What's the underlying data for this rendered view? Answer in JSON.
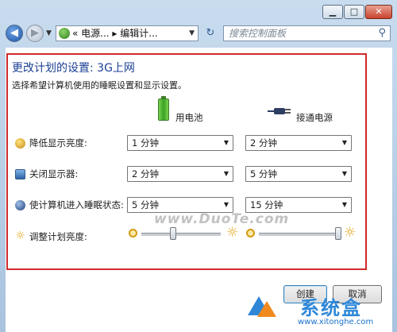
{
  "window": {
    "min_glyph": "▁",
    "max_glyph": "□",
    "close_glyph": "✕"
  },
  "nav": {
    "back_glyph": "◀",
    "forward_glyph": "▶",
    "dropdown_glyph": "▼",
    "address_text": "« 电源... ▸ 编辑计...",
    "address_dropdown_glyph": "▼",
    "refresh_glyph": "↻",
    "search_placeholder": "搜索控制面板",
    "search_glyph": "⚲"
  },
  "page": {
    "title": "更改计划的设置: 3G上网",
    "subtitle": "选择希望计算机使用的睡眠设置和显示设置。",
    "col_battery": "用电池",
    "col_plugged": "接通电源"
  },
  "rows": [
    {
      "label": "降低显示亮度:",
      "battery": "1 分钟",
      "plugged": "2 分钟"
    },
    {
      "label": "关闭显示器:",
      "battery": "2 分钟",
      "plugged": "5 分钟"
    },
    {
      "label": "使计算机进入睡眠状态:",
      "battery": "5 分钟",
      "plugged": "15 分钟"
    }
  ],
  "brightness": {
    "label": "调整计划亮度:",
    "battery_level": 0.4,
    "plugged_level": 1.0,
    "sun_glyph": "☼"
  },
  "buttons": {
    "create": "创建",
    "cancel": "取消"
  },
  "select_arrow_glyph": "▼",
  "watermarks": {
    "duote": "www.DuoTe.com",
    "brand_cn": "系统盒",
    "site": "www.xitonghe.com"
  },
  "colors": {
    "title": "#1c3f95",
    "highlight_border": "#cf2b2b"
  }
}
